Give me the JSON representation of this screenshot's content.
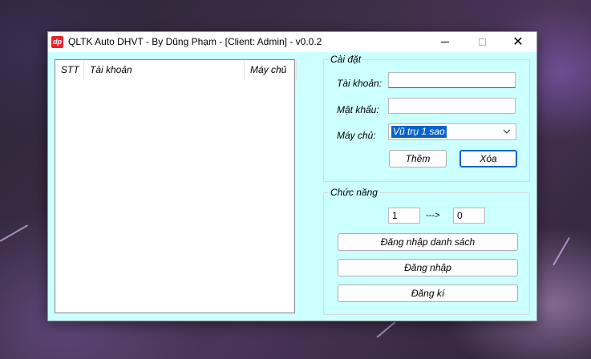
{
  "window": {
    "title": "QLTK Auto DHVT - By Dũng Phạm - [Client: Admin] - v0.0.2",
    "icon_text": "dp"
  },
  "titlebar_buttons": {
    "minimize": "minimize-icon",
    "maximize": "maximize-icon",
    "close": "close-icon"
  },
  "account_list": {
    "columns": [
      "STT",
      "Tài khoản",
      "Máy chủ"
    ],
    "rows": []
  },
  "settings": {
    "legend": "Cài đặt",
    "account_label": "Tài khoản:",
    "account_value": "",
    "password_label": "Mật khẩu:",
    "password_value": "",
    "server_label": "Máy chủ:",
    "server_selected": "Vũ trụ 1 sao",
    "add_button": "Thêm",
    "delete_button": "Xóa"
  },
  "functions": {
    "legend": "Chức năng",
    "range_from": "1",
    "range_arrow": "--->",
    "range_to": "0",
    "login_list_button": "Đăng nhập danh sách",
    "login_button": "Đăng nhập",
    "register_button": "Đăng kí"
  },
  "colors": {
    "window_bg": "#ccffff",
    "accent": "#0a64c8",
    "app_icon": "#e8232b"
  }
}
